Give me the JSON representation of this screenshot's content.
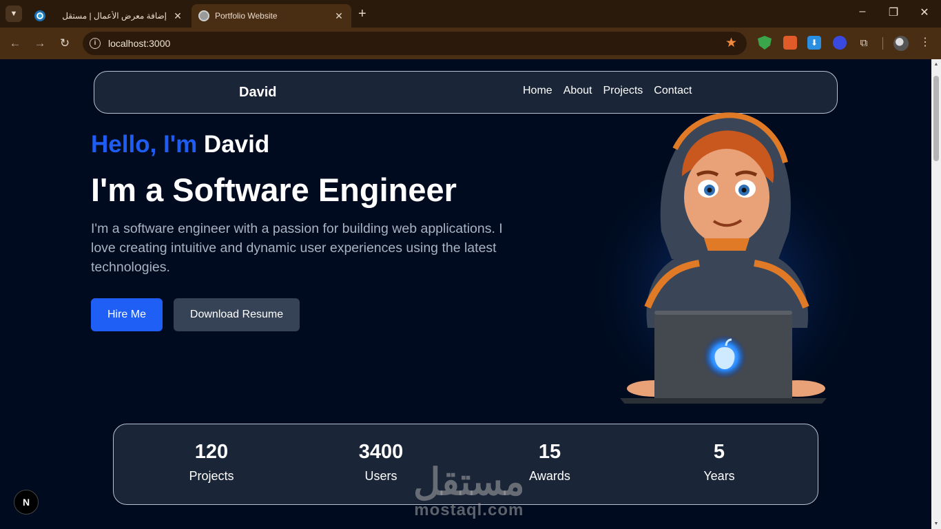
{
  "browser": {
    "tabs": [
      {
        "title": "إضافة معرض الأعمال | مستقل",
        "active": false
      },
      {
        "title": "Portfolio Website",
        "active": true
      }
    ],
    "url": "localhost:3000",
    "new_tab_glyph": "+",
    "close_glyph": "✕",
    "window_controls": [
      "–",
      "❐",
      "✕"
    ],
    "icons": {
      "tab_list": "chevron-down-icon",
      "back": "arrow-left-icon",
      "forward": "arrow-right-icon",
      "reload": "reload-icon",
      "site_info": "info-icon",
      "bookmark": "star-icon",
      "extensions": [
        "shield-extension-icon",
        "red-extension-icon",
        "download-extension-icon",
        "blue-extension-icon",
        "puzzle-icon"
      ],
      "profile": "profile-avatar",
      "menu": "more-vert-icon"
    },
    "colors": {
      "tabbar": "#2a1a0c",
      "toolbar": "#4a2e14",
      "bookmark_star": "#f08a3e"
    }
  },
  "site": {
    "brand": "David",
    "nav": [
      "Home",
      "About",
      "Projects",
      "Contact"
    ],
    "hero": {
      "greeting": "Hello, I'm",
      "name": "David",
      "role": "I'm a Software Engineer",
      "description": "I'm a software engineer with a passion for building web applications. I love creating intuitive and dynamic user experiences using the latest technologies.",
      "primary_cta": "Hire Me",
      "secondary_cta": "Download Resume"
    },
    "stats": [
      {
        "value": "120",
        "label": "Projects"
      },
      {
        "value": "3400",
        "label": "Users"
      },
      {
        "value": "15",
        "label": "Awards"
      },
      {
        "value": "5",
        "label": "Years"
      }
    ],
    "colors": {
      "accent": "#1e5cf2",
      "background": "#000b1f",
      "card": "#1a2537"
    }
  },
  "overlay": {
    "nextjs_badge": "N",
    "watermark_arabic": "مستقل",
    "watermark_latin": "mostaql.com"
  }
}
